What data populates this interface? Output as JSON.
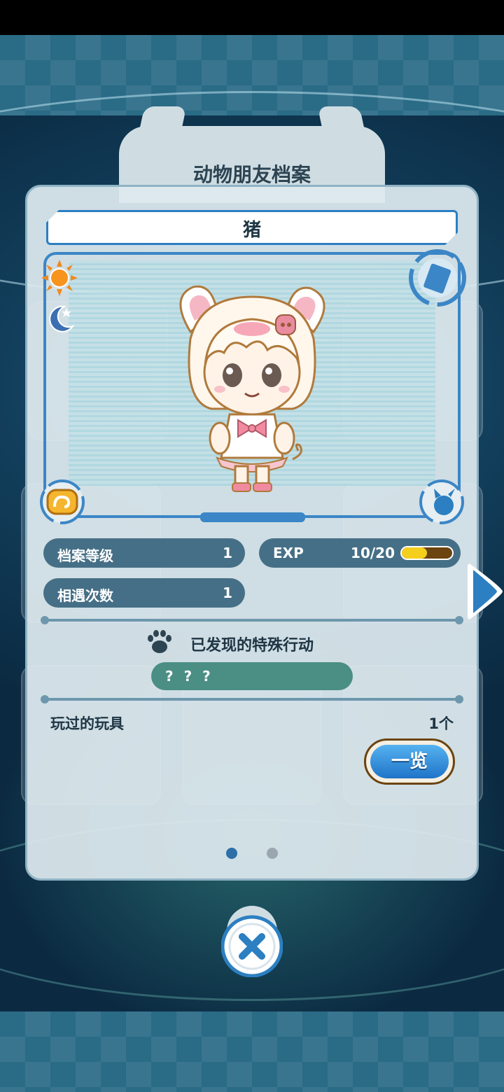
{
  "header": {
    "title": "动物朋友档案"
  },
  "profile": {
    "name": "猪",
    "level_label": "档案等级",
    "level_value": "1",
    "exp_label": "EXP",
    "exp_value": "10/20",
    "exp_progress": 0.5,
    "encounter_label": "相遇次数",
    "encounter_value": "1"
  },
  "behaviors": {
    "title": "已发现的特殊行动",
    "items": [
      "? ? ?"
    ]
  },
  "toys": {
    "label": "玩过的玩具",
    "count": "1个",
    "list_button": "一览"
  },
  "pagination": {
    "current": 1,
    "total": 2
  },
  "icons": {
    "day": "sun-icon",
    "night": "moon-icon",
    "card": "disc-icon",
    "left_badge": "paw-badge-icon",
    "right_badge": "cat-badge-icon",
    "section": "paw-print-icon",
    "next": "chevron-right-icon",
    "close": "close-icon"
  },
  "colors": {
    "accent_blue": "#2c7fc1",
    "stat_bg": "#456f86",
    "behavior_bg": "#4a8e84",
    "exp_fill": "#f5cf1e"
  }
}
